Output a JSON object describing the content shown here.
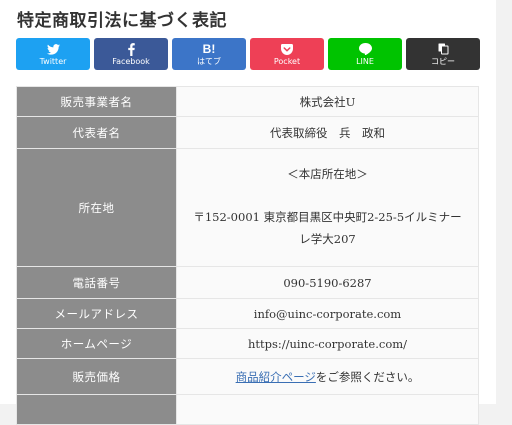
{
  "heading": "特定商取引法に基づく表記",
  "share_buttons": [
    {
      "label": "Twitter",
      "color": "#1da1f2",
      "icon": "twitter-bird-icon"
    },
    {
      "label": "Facebook",
      "color": "#3b5998",
      "icon": "facebook-f-icon"
    },
    {
      "label": "はてブ",
      "color": "#3c75c8",
      "icon": "hatena-bookmark-icon",
      "glyph": "B!"
    },
    {
      "label": "Pocket",
      "color": "#ee4056",
      "icon": "pocket-icon"
    },
    {
      "label": "LINE",
      "color": "#00c300",
      "icon": "line-icon"
    },
    {
      "label": "コピー",
      "color": "#333333",
      "icon": "copy-icon"
    }
  ],
  "table": {
    "seller": {
      "key": "販売事業者名",
      "value": "株式会社U"
    },
    "representative": {
      "key": "代表者名",
      "value": "代表取締役　兵　政和"
    },
    "address": {
      "key": "所在地",
      "head": "＜本店所在地＞",
      "line1": "〒152-0001 東京都目黒区中央町2-25-5イルミナー",
      "line2": "レ学大207"
    },
    "phone": {
      "key": "電話番号",
      "value": "090-5190-6287"
    },
    "email": {
      "key": "メールアドレス",
      "value": "info@uinc-corporate.com"
    },
    "homepage": {
      "key": "ホームページ",
      "value": "https://uinc-corporate.com/"
    },
    "price": {
      "key": "販売価格",
      "link_text": "商品紹介ページ",
      "suffix": "をご参照ください。"
    }
  }
}
